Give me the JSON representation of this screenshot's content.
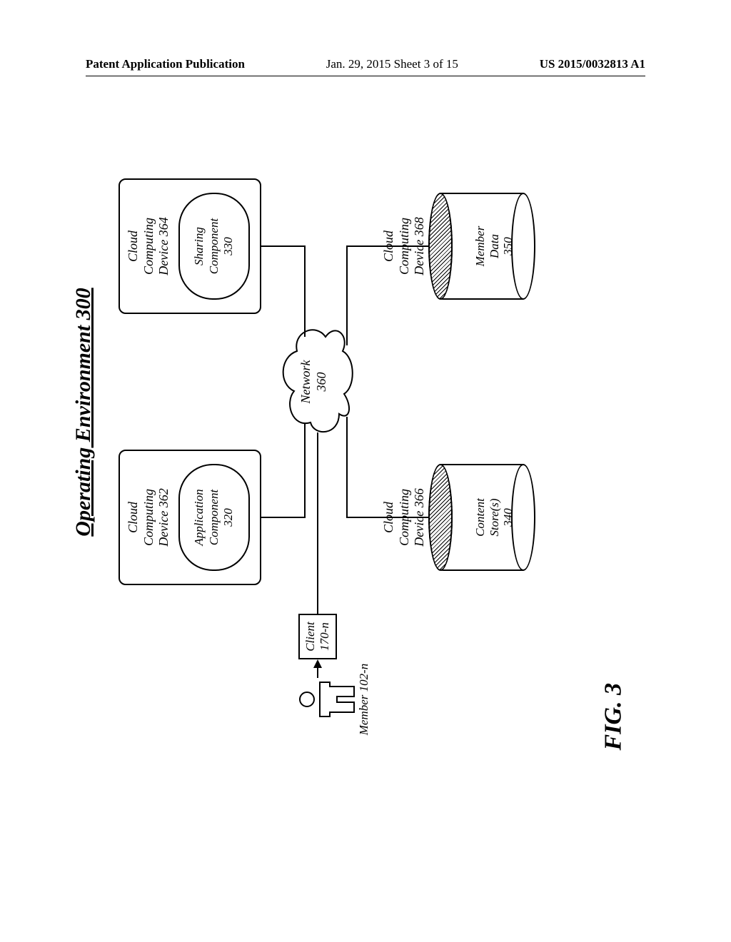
{
  "header": {
    "left": "Patent Application Publication",
    "center": "Jan. 29, 2015  Sheet 3 of 15",
    "right": "US 2015/0032813 A1"
  },
  "figure": {
    "environment_title": "Operating Environment 300",
    "figure_label": "FIG. 3",
    "devices": {
      "d362": {
        "title_l1": "Cloud",
        "title_l2": "Computing",
        "title_l3": "Device 362",
        "inner_l1": "Application",
        "inner_l2": "Component",
        "inner_l3": "320"
      },
      "d364": {
        "title_l1": "Cloud",
        "title_l2": "Computing",
        "title_l3": "Device 364",
        "inner_l1": "Sharing",
        "inner_l2": "Component",
        "inner_l3": "330"
      },
      "d366": {
        "title_l1": "Cloud",
        "title_l2": "Computing",
        "title_l3": "Device 366",
        "store_l1": "Content",
        "store_l2": "Store(s)",
        "store_l3": "340"
      },
      "d368": {
        "title_l1": "Cloud",
        "title_l2": "Computing",
        "title_l3": "Device 368",
        "store_l1": "Member",
        "store_l2": "Data",
        "store_l3": "350"
      }
    },
    "network": {
      "l1": "Network",
      "l2": "360"
    },
    "client": {
      "l1": "Client",
      "l2": "170-n"
    },
    "member": {
      "label": "Member 102-n"
    }
  }
}
